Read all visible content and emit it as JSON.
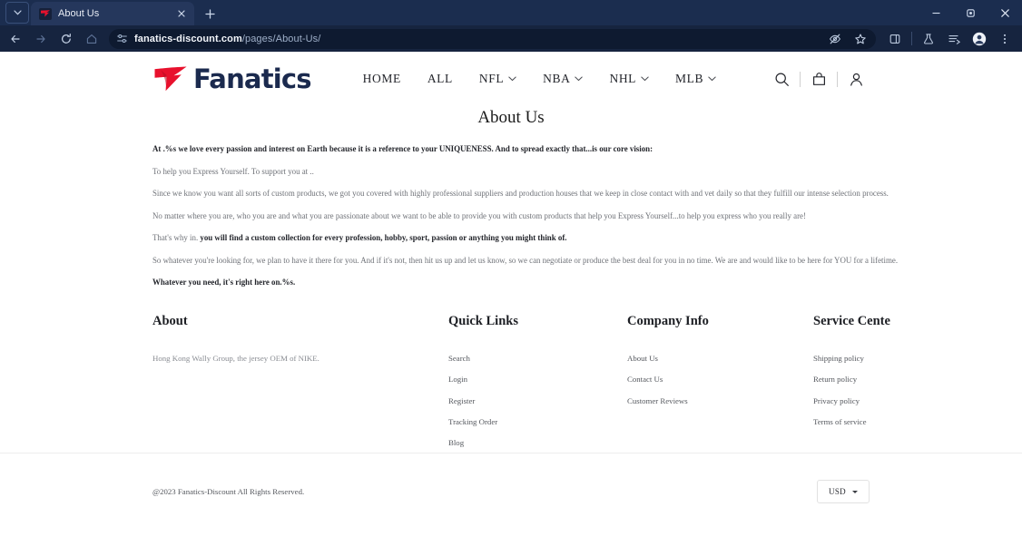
{
  "browser": {
    "tab": {
      "title": "About Us",
      "favicon_icon": "fanatics-favicon",
      "close_icon": "close-icon"
    },
    "tab_list_icon": "chevron-down-icon",
    "new_tab_icon": "plus-icon",
    "window_controls": {
      "minimize_icon": "minimize-icon",
      "maximize_icon": "maximize-icon",
      "close_icon": "window-close-icon"
    },
    "toolbar": {
      "back_icon": "back-arrow-icon",
      "forward_icon": "forward-arrow-icon",
      "reload_icon": "reload-icon",
      "home_icon": "home-icon",
      "site_info_icon": "site-settings-icon",
      "url_domain": "fanatics-discount.com",
      "url_path": "/pages/About-Us/",
      "tracking_protection_icon": "eye-slash-icon",
      "bookmark_icon": "star-icon",
      "split_screen_icon": "split-screen-icon",
      "experiments_icon": "flask-icon",
      "collections_icon": "collections-icon",
      "profile_icon": "profile-avatar-icon",
      "menu_icon": "three-dots-menu-icon"
    },
    "theme": {
      "tabstrip_bg": "#1b2d4f",
      "toolbar_bg": "#16243f",
      "active_tab_bg": "#25375c",
      "omnibox_bg": "#0e1a30"
    }
  },
  "site": {
    "logo": {
      "text": "Fanatics",
      "mark_icon": "fanatics-flag-icon",
      "mark_color": "#e8112d",
      "text_color": "#1b2a4e"
    },
    "nav": [
      {
        "label": "HOME",
        "has_dropdown": false
      },
      {
        "label": "ALL",
        "has_dropdown": false
      },
      {
        "label": "NFL",
        "has_dropdown": true
      },
      {
        "label": "NBA",
        "has_dropdown": true
      },
      {
        "label": "NHL",
        "has_dropdown": true
      },
      {
        "label": "MLB",
        "has_dropdown": true
      }
    ],
    "header_icons": {
      "search_icon": "search-icon",
      "cart_icon": "shopping-bag-icon",
      "account_icon": "user-account-icon"
    }
  },
  "main": {
    "title": "About Us",
    "paragraphs": [
      {
        "text": "At .%s we love every passion and interest on Earth because it is a reference to your UNIQUENESS. And to spread exactly that...is our core vision:",
        "bold": true
      },
      {
        "text": "To help you Express Yourself. To support you at ..",
        "bold": false
      },
      {
        "text": "Since we know you want all sorts of custom products, we got you covered with highly professional suppliers and production houses that we keep in close contact with and vet daily so that they fulfill our intense selection process.",
        "bold": false
      },
      {
        "text": "No matter where you are, who you are and what you are passionate about we want to be able to provide you with custom products that help you Express Yourself...to help you express who you really are!",
        "bold": false
      },
      {
        "lead": "That's why in.",
        "text": " you will find a custom collection for every profession, hobby, sport, passion or anything you might think of.",
        "bold": "partial"
      },
      {
        "text": "So whatever you're looking for, we plan to have it there for you. And if it's not, then hit us up and let us know, so we can negotiate or produce the best deal for you in no time. We are and would like to be here for YOU for a lifetime.",
        "bold": false
      },
      {
        "text": "Whatever you need, it's right here on.%s.",
        "bold": true
      }
    ]
  },
  "footer": {
    "columns": [
      {
        "heading": "About",
        "description": "Hong Kong Wally Group, the jersey OEM of NIKE.",
        "links": []
      },
      {
        "heading": "Quick Links",
        "description": "",
        "links": [
          "Search",
          "Login",
          "Register",
          "Tracking Order",
          "Blog"
        ]
      },
      {
        "heading": "Company Info",
        "description": "",
        "links": [
          "About Us",
          "Contact Us",
          "Customer Reviews"
        ]
      },
      {
        "heading": "Service Cente",
        "description": "",
        "links": [
          "Shipping policy",
          "Return policy",
          "Privacy policy",
          "Terms of service"
        ]
      }
    ],
    "copyright": "@2023 Fanatics-Discount All Rights Reserved.",
    "currency": {
      "selected": "USD",
      "caret_icon": "caret-down-icon"
    }
  }
}
